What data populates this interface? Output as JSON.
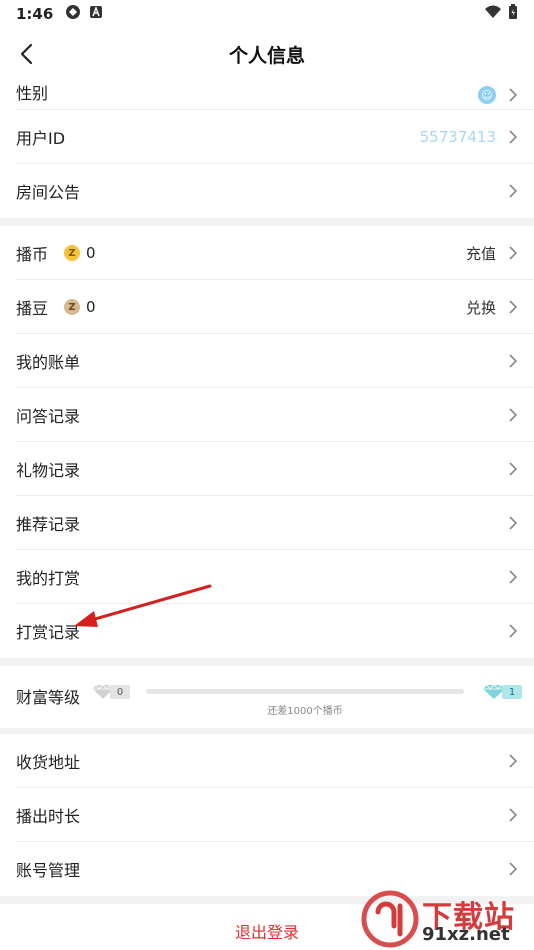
{
  "status_bar": {
    "time": "1:46"
  },
  "header": {
    "title": "个人信息"
  },
  "profile_rows": [
    {
      "label": "性别"
    },
    {
      "label": "用户ID",
      "value": "55737413"
    },
    {
      "label": "房间公告"
    }
  ],
  "wallet": {
    "coin": {
      "label": "播币",
      "icon_glyph": "Z",
      "count": "0",
      "action": "充值"
    },
    "bean": {
      "label": "播豆",
      "icon_glyph": "Z",
      "count": "0",
      "action": "兑换"
    }
  },
  "records": [
    {
      "label": "我的账单"
    },
    {
      "label": "问答记录"
    },
    {
      "label": "礼物记录"
    },
    {
      "label": "推荐记录"
    },
    {
      "label": "我的打赏"
    },
    {
      "label": "打赏记录"
    }
  ],
  "wealth": {
    "label": "财富等级",
    "current_level": "0",
    "next_level": "1",
    "progress_fraction": 0,
    "note": "还差1000个播币"
  },
  "settings_rows": [
    {
      "label": "收货地址"
    },
    {
      "label": "播出时长"
    },
    {
      "label": "账号管理"
    }
  ],
  "logout": {
    "label": "退出登录"
  },
  "watermark": {
    "logo_text": "下载站",
    "url": "91xz.net"
  },
  "colors": {
    "accent_red": "#e0302f",
    "id_value": "#a8d8ef",
    "divider": "#ececec",
    "section_gap": "#f2f2f2"
  }
}
